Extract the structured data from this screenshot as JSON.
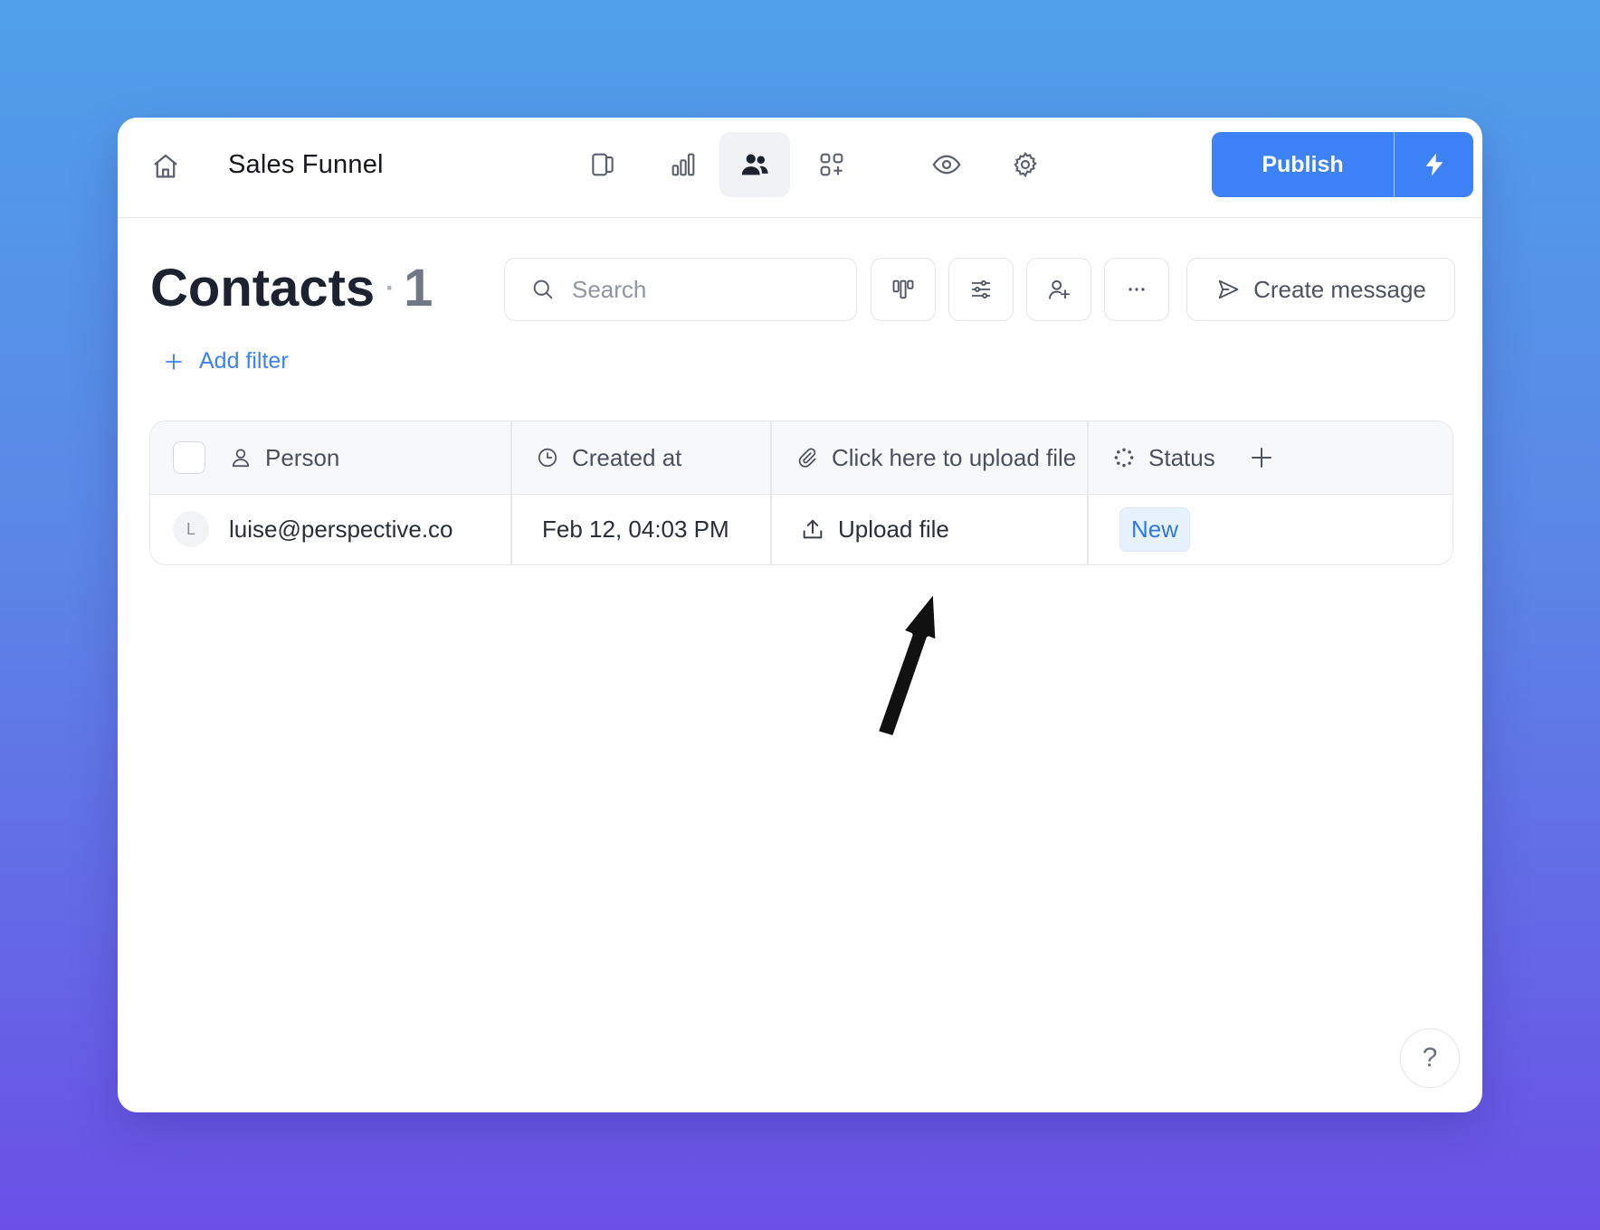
{
  "header": {
    "title": "Sales Funnel",
    "nav_icons": [
      "sidebar-panel-icon",
      "bar-chart-icon",
      "users-icon",
      "apps-add-icon"
    ],
    "active_nav": "users-icon",
    "publish_label": "Publish"
  },
  "page": {
    "title": "Contacts",
    "separator": "·",
    "count": "1",
    "search_placeholder": "Search",
    "create_message_label": "Create message",
    "add_filter_label": "Add filter"
  },
  "table": {
    "columns": [
      {
        "label": "Person",
        "icon": "person-icon"
      },
      {
        "label": "Created at",
        "icon": "clock-icon"
      },
      {
        "label": "Click here to upload file",
        "icon": "paperclip-icon"
      },
      {
        "label": "Status",
        "icon": "loader-icon"
      }
    ],
    "rows": [
      {
        "avatar_initial": "L",
        "person": "luise@perspective.co",
        "created_at": "Feb 12, 04:03 PM",
        "upload": "Upload file",
        "status": "New"
      }
    ]
  },
  "help_label": "?",
  "colors": {
    "accent": "#3c82f6",
    "status_new_bg": "#e8f1fe",
    "status_new_text": "#2f79ee"
  }
}
